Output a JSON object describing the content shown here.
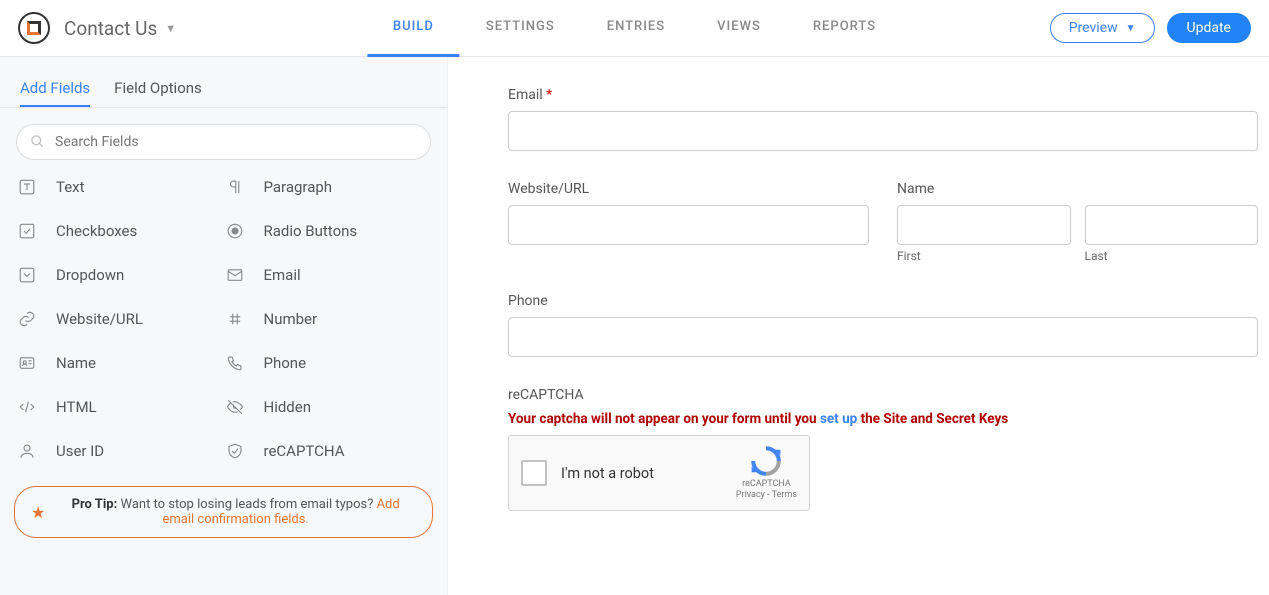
{
  "header": {
    "form_name": "Contact Us",
    "tabs": [
      "BUILD",
      "SETTINGS",
      "ENTRIES",
      "VIEWS",
      "REPORTS"
    ],
    "active_tab": 0,
    "preview_label": "Preview",
    "update_label": "Update"
  },
  "sidebar": {
    "tabs": {
      "add": "Add Fields",
      "options": "Field Options",
      "active": "add"
    },
    "search_placeholder": "Search Fields",
    "fields": [
      {
        "label": "Text",
        "icon": "text"
      },
      {
        "label": "Paragraph",
        "icon": "paragraph"
      },
      {
        "label": "Checkboxes",
        "icon": "checkbox"
      },
      {
        "label": "Radio Buttons",
        "icon": "radio"
      },
      {
        "label": "Dropdown",
        "icon": "dropdown"
      },
      {
        "label": "Email",
        "icon": "email"
      },
      {
        "label": "Website/URL",
        "icon": "url"
      },
      {
        "label": "Number",
        "icon": "number"
      },
      {
        "label": "Name",
        "icon": "name"
      },
      {
        "label": "Phone",
        "icon": "phone"
      },
      {
        "label": "HTML",
        "icon": "html"
      },
      {
        "label": "Hidden",
        "icon": "hidden"
      },
      {
        "label": "User ID",
        "icon": "user"
      },
      {
        "label": "reCAPTCHA",
        "icon": "shield"
      }
    ],
    "protip": {
      "bold": "Pro Tip:",
      "text": " Want to stop losing leads from email typos? ",
      "link": "Add email confirmation fields."
    }
  },
  "form": {
    "email": {
      "label": "Email",
      "required": true
    },
    "website": {
      "label": "Website/URL"
    },
    "name": {
      "label": "Name",
      "sub1": "First",
      "sub2": "Last"
    },
    "phone": {
      "label": "Phone"
    },
    "recaptcha": {
      "label": "reCAPTCHA",
      "warning_pre": "Your captcha will not appear on your form until you ",
      "warning_link": "set up",
      "warning_post": " the Site and Secret Keys",
      "box_text": "I'm not a robot",
      "logo": "reCAPTCHA",
      "terms": "Privacy - Terms"
    }
  }
}
